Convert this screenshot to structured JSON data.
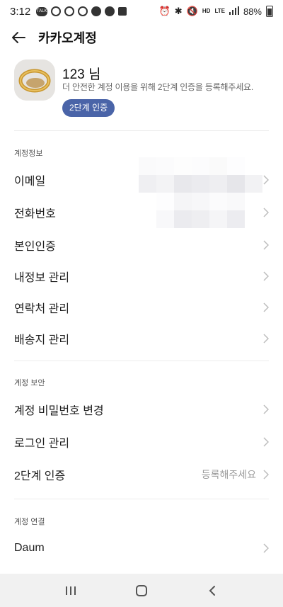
{
  "status_bar": {
    "time": "3:12",
    "network": "HD",
    "network2": "LTE",
    "battery": "88%"
  },
  "header": {
    "title": "카카오계정"
  },
  "profile": {
    "name": "123 님",
    "description": "더 안전한 계정 이용을 위해 2단계 인증을 등록해주세요.",
    "badge_label": "2단계 인증"
  },
  "sections": {
    "info": {
      "label": "계정정보",
      "items": [
        "이메일",
        "전화번호",
        "본인인증",
        "내정보 관리",
        "연락처 관리",
        "배송지 관리"
      ]
    },
    "security": {
      "label": "계정 보안",
      "items": [
        "계정 비밀번호 변경",
        "로그인 관리",
        "2단계 인증"
      ],
      "two_step_value": "등록해주세요"
    },
    "link": {
      "label": "계정 연결",
      "items": [
        "Daum"
      ]
    }
  },
  "colors": {
    "badge": "#4a64a8",
    "navbar": "#f1f1f1",
    "divider": "#ececec"
  }
}
